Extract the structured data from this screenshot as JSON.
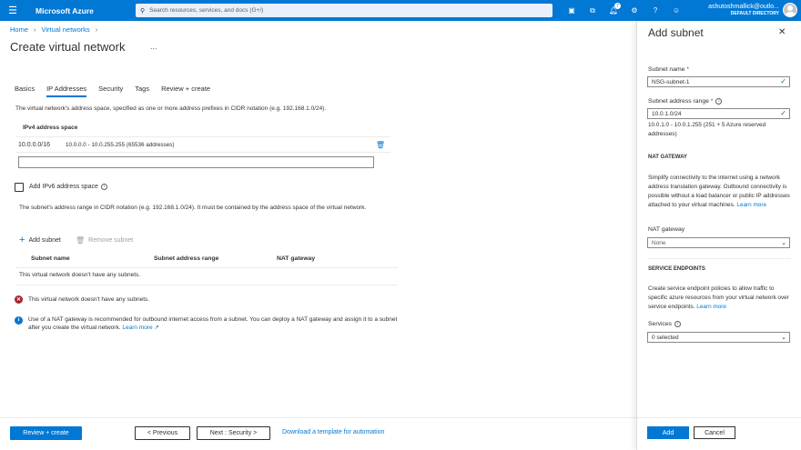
{
  "topbar": {
    "brand": "Microsoft Azure",
    "search_placeholder": "Search resources, services, and docs (G+/)",
    "notification_count": "7",
    "account_user": "ashutoshmallick@outlo...",
    "account_directory": "DEFAULT DIRECTORY",
    "icons": [
      "menu-icon",
      "search-icon",
      "cloud-shell-icon",
      "directory-filter-icon",
      "bell-icon",
      "gear-icon",
      "help-icon",
      "feedback-icon",
      "avatar"
    ],
    "brand_color": "#0078d4"
  },
  "breadcrumb": {
    "home": "Home",
    "current": "Virtual networks"
  },
  "page": {
    "title": "Create virtual network",
    "more": "...",
    "tabs": [
      "Basics",
      "IP Addresses",
      "Security",
      "Tags",
      "Review + create"
    ],
    "active_tab": "IP Addresses",
    "description": "The virtual network's address space, specified as one or more address prefixes in CIDR notation (e.g. 192.168.1.0/24).",
    "ipv4_header": "IPv4 address space",
    "ipv4_address": "10.0.0.0/16",
    "ipv4_range": "10.0.0.0 - 10.0.255.255 (65536 addresses)",
    "ipv6_label": "Add IPv6 address space",
    "ipv6_checked": false,
    "subnet_note": "The subnet's address range in CIDR notation (e.g. 192.168.1.0/24). It must be contained by the address space of the virtual network.",
    "add_subnet": "Add subnet",
    "remove_subnet": "Remove subnet",
    "columns": [
      "Subnet name",
      "Subnet address range",
      "NAT gateway"
    ],
    "empty_text": "This virtual network doesn't have any subnets.",
    "error_text": "This virtual network doesn't have any subnets.",
    "nat_info": "Use of a NAT gateway is recommended for outbound internet access from a subnet. You can deploy a NAT gateway and assign it to a subnet after you create the virtual network.",
    "learn_more": "Learn more"
  },
  "footer": {
    "review": "Review + create",
    "previous": "< Previous",
    "next": "Next : Security >",
    "download": "Download a template for automation"
  },
  "panel": {
    "title": "Add subnet",
    "subnet_name_label": "Subnet name",
    "subnet_name_value": "NSG-subnet-1",
    "range_label": "Subnet address range",
    "range_value": "10.0.1.0/24",
    "range_hint": "10.0.1.0 - 10.0.1.255 (251 + 5 Azure reserved addresses)",
    "nat_section": "NAT GATEWAY",
    "nat_desc": "Simplify connectivity to the internet using a network address translation gateway. Outbound connectivity is possible without a load balancer or public IP addresses attached to your virtual machines.",
    "learn_more": "Learn more",
    "nat_label": "NAT gateway",
    "nat_value": "None",
    "svc_section": "SERVICE ENDPOINTS",
    "svc_desc": "Create service endpoint policies to allow traffic to specific azure resources from your virtual network over service endpoints.",
    "services_label": "Services",
    "services_value": "0 selected",
    "add": "Add",
    "cancel": "Cancel"
  }
}
